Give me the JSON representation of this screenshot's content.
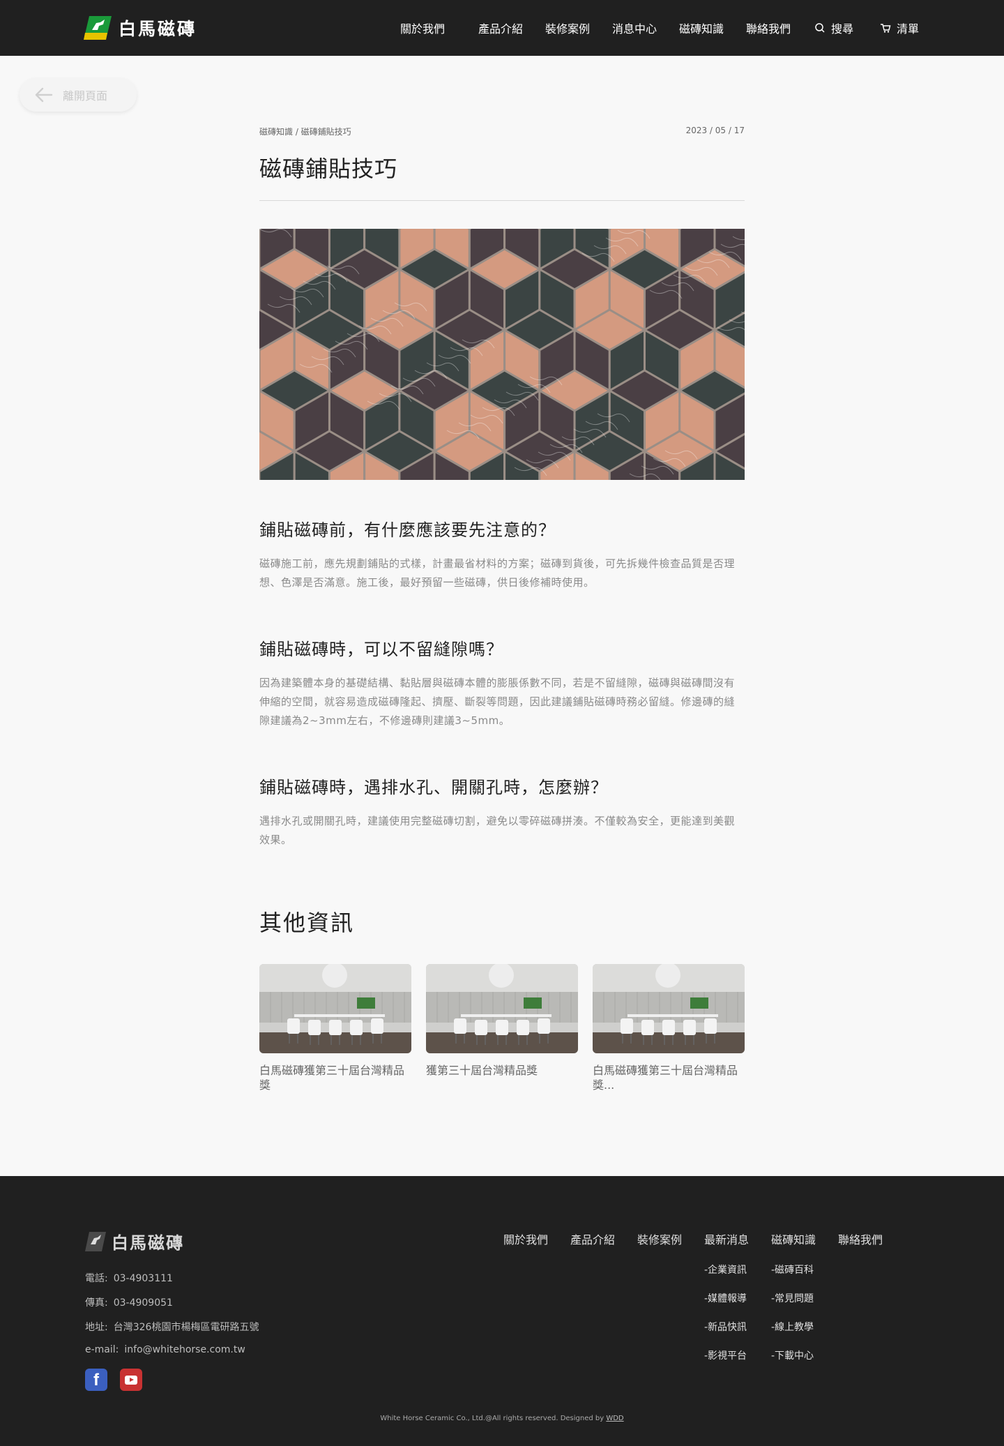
{
  "header": {
    "logo_text": "白馬磁磚",
    "nav": [
      "關於我們",
      "產品介紹",
      "裝修案例",
      "消息中心",
      "磁磚知識",
      "聯絡我們"
    ],
    "search_label": "搜尋",
    "cart_label": "清單"
  },
  "back_button": {
    "label": "離開頁面"
  },
  "article": {
    "breadcrumb": "磁磚知識 / 磁磚鋪貼技巧",
    "date": "2023 / 05 / 17",
    "title": "磁磚鋪貼技巧",
    "sections": [
      {
        "heading": "鋪貼磁磚前，有什麼應該要先注意的？",
        "body": "磁磚施工前，應先規劃鋪貼的式樣，計畫最省材料的方案；磁磚到貨後，可先拆幾件檢查品質是否理想、色澤是否滿意。施工後，最好預留一些磁磚，供日後修補時使用。"
      },
      {
        "heading": "鋪貼磁磚時，可以不留縫隙嗎？",
        "body": "因為建築體本身的基礎結構、黏貼層與磁磚本體的膨脹係數不同，若是不留縫隙，磁磚與磁磚間沒有伸縮的空間，就容易造成磁磚隆起、擠壓、斷裂等問題，因此建議鋪貼磁磚時務必留縫。修邊磚的縫隙建議為2~3mm左右，不修邊磚則建議3~5mm。"
      },
      {
        "heading": "鋪貼磁磚時，遇排水孔、開關孔時，怎麼辦？",
        "body": "遇排水孔或開關孔時，建議使用完整磁磚切割，避免以零碎磁磚拼湊。不僅較為安全，更能達到美觀效果。"
      }
    ]
  },
  "other": {
    "title": "其他資訊",
    "cards": [
      {
        "title": "白馬磁磚獲第三十屆台灣精品獎"
      },
      {
        "title": "獲第三十屆台灣精品獎"
      },
      {
        "title": "白馬磁磚獲第三十屆台灣精品獎..."
      }
    ]
  },
  "footer": {
    "logo_text": "白馬磁磚",
    "info": [
      {
        "label": "電話:",
        "value": "03-4903111"
      },
      {
        "label": "傳真:",
        "value": "03-4909051"
      },
      {
        "label": "地址:",
        "value": "台灣326桃園市楊梅區電研路五號"
      },
      {
        "label": "e-mail:",
        "value": "info@whitehorse.com.tw"
      }
    ],
    "nav": [
      "關於我們",
      "產品介紹",
      "裝修案例",
      "最新消息",
      "磁磚知識",
      "聯絡我們"
    ],
    "news_sub": [
      "-企業資訊",
      "-媒體報導",
      "-新品快訊",
      "-影視平台"
    ],
    "knowledge_sub": [
      "-磁磚百科",
      "-常見問題",
      "-線上教學",
      "-下載中心"
    ],
    "copyright": "White Horse Ceramic Co., Ltd.@All rights reserved. Designed by ",
    "designer": "WDD"
  }
}
